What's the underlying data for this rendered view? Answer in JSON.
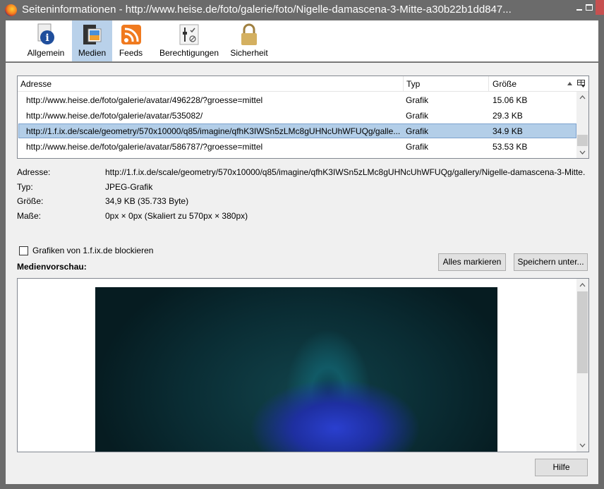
{
  "window": {
    "title": "Seiteninformationen - http://www.heise.de/foto/galerie/foto/Nigelle-damascena-3-Mitte-a30b22b1dd847...",
    "close": "x"
  },
  "tabs": [
    {
      "label": "Allgemein"
    },
    {
      "label": "Medien"
    },
    {
      "label": "Feeds"
    },
    {
      "label": "Berechtigungen"
    },
    {
      "label": "Sicherheit"
    }
  ],
  "table": {
    "headers": {
      "address": "Adresse",
      "type": "Typ",
      "size": "Größe"
    },
    "rows": [
      {
        "address": "http://www.heise.de/foto/galerie/avatar/496228/?groesse=mittel",
        "type": "Grafik",
        "size": "15.06 KB"
      },
      {
        "address": "http://www.heise.de/foto/galerie/avatar/535082/",
        "type": "Grafik",
        "size": "29.3 KB"
      },
      {
        "address": "http://1.f.ix.de/scale/geometry/570x10000/q85/imagine/qfhK3IWSn5zLMc8gUHNcUhWFUQg/galle...",
        "type": "Grafik",
        "size": "34.9 KB"
      },
      {
        "address": "http://www.heise.de/foto/galerie/avatar/586787/?groesse=mittel",
        "type": "Grafik",
        "size": "53.53 KB"
      }
    ]
  },
  "details": {
    "address_label": "Adresse:",
    "address": "http://1.f.ix.de/scale/geometry/570x10000/q85/imagine/qfhK3IWSn5zLMc8gUHNcUhWFUQg/gallery/Nigelle-damascena-3-Mitte.",
    "type_label": "Typ:",
    "type": "JPEG-Grafik",
    "size_label": "Größe:",
    "size": "34,9 KB (35.733 Byte)",
    "dims_label": "Maße:",
    "dims": "0px × 0px (Skaliert zu 570px × 380px)"
  },
  "block_label": "Grafiken von 1.f.ix.de blockieren",
  "preview_label": "Medienvorschau:",
  "buttons": {
    "select_all": "Alles markieren",
    "save_as": "Speichern unter...",
    "help": "Hilfe"
  }
}
